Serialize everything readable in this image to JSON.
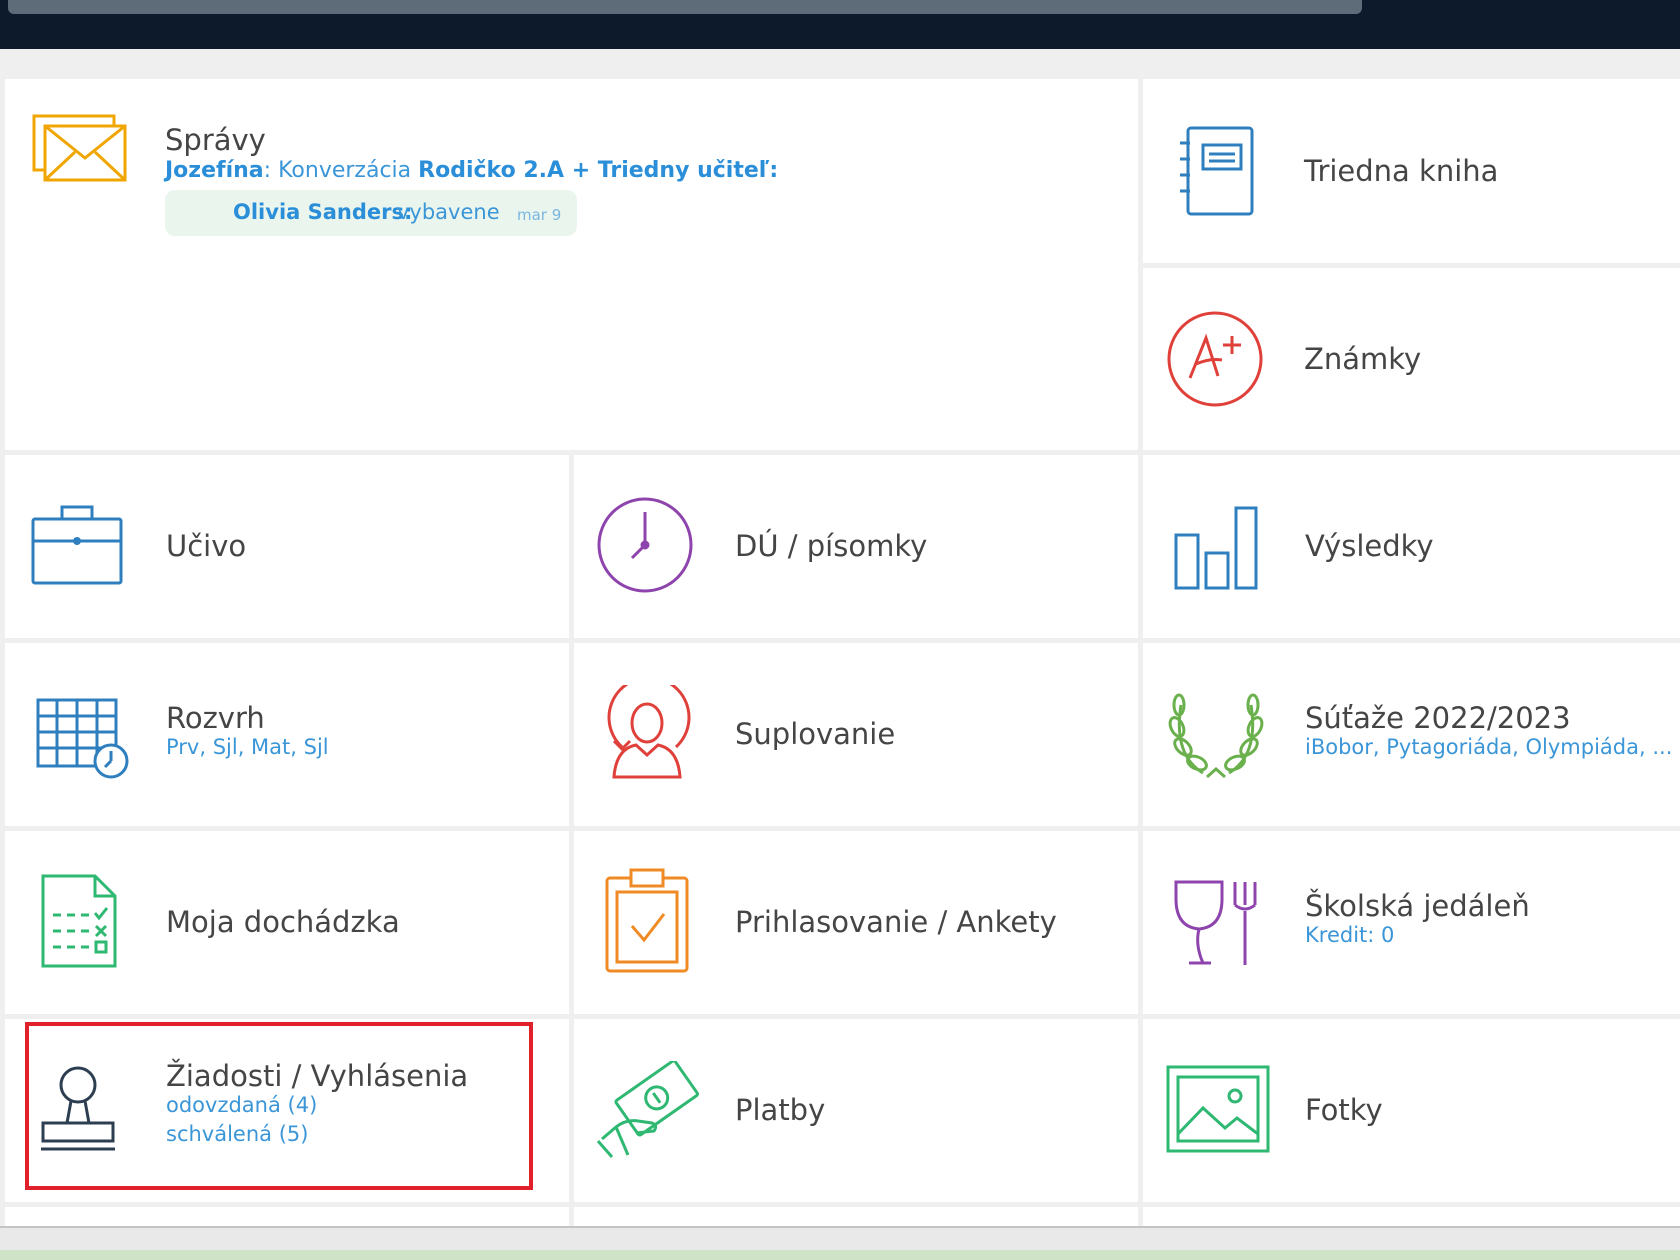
{
  "tiles": {
    "spravy": {
      "title": "Správy",
      "sender": "Jozefína",
      "colon": ":",
      "subject": "Konverzácia",
      "recipients": "Rodičko 2.A + Triedny učiteľ:",
      "reply_author": "Olivia Sanders:",
      "reply_text": "vybavene",
      "reply_date": "mar 9"
    },
    "triedna_kniha": {
      "title": "Triedna kniha"
    },
    "znamky": {
      "title": "Známky"
    },
    "ucivo": {
      "title": "Učivo"
    },
    "du_pisomky": {
      "title": "DÚ / písomky"
    },
    "vysledky": {
      "title": "Výsledky"
    },
    "rozvrh": {
      "title": "Rozvrh",
      "subtitle": "Prv, Sjl, Mat, Sjl"
    },
    "suplovanie": {
      "title": "Suplovanie"
    },
    "sutaze": {
      "title": "Súťaže 2022/2023",
      "subtitle": "iBobor, Pytagoriáda, Olympiáda, ..."
    },
    "dochadzka": {
      "title": "Moja dochádzka"
    },
    "prihlasovanie": {
      "title": "Prihlasovanie / Ankety"
    },
    "jedalen": {
      "title": "Školská jedáleň",
      "subtitle": "Kredit: 0"
    },
    "ziadosti": {
      "title": "Žiadosti / Vyhlásenia",
      "sub1": "odovzdaná (4)",
      "sub2": "schválená (5)"
    },
    "platby": {
      "title": "Platby"
    },
    "fotky": {
      "title": "Fotky"
    }
  },
  "icons": {
    "spravy": "envelope-icon",
    "triedna_kniha": "notebook-icon",
    "znamky": "grade-a-plus-icon",
    "ucivo": "briefcase-icon",
    "du_pisomky": "clock-icon",
    "vysledky": "bar-chart-icon",
    "rozvrh": "timetable-icon",
    "suplovanie": "substitute-person-icon",
    "sutaze": "laurel-wreath-icon",
    "dochadzka": "attendance-sheet-icon",
    "prihlasovanie": "clipboard-check-icon",
    "jedalen": "glass-fork-icon",
    "ziadosti": "stamp-icon",
    "platby": "money-hand-icon",
    "fotky": "picture-icon"
  },
  "colors": {
    "envelope": "#f0a500",
    "blue": "#2f7fbf",
    "red": "#e0403a",
    "purple": "#8e44ad",
    "green": "#2eb872",
    "lightgreen": "#6ab04c",
    "orange": "#f08a24",
    "link": "#3b96d8",
    "highlight": "#e0202a"
  }
}
